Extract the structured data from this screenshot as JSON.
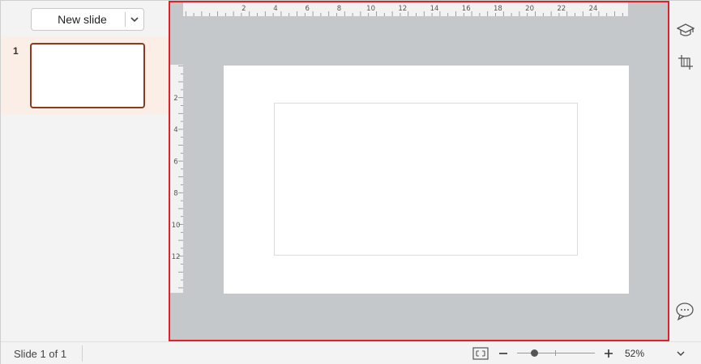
{
  "sidebar": {
    "new_slide_label": "New slide",
    "slides": [
      {
        "number": "1"
      }
    ]
  },
  "ruler": {
    "horizontal_labels": [
      "2",
      "4",
      "6",
      "8",
      "10",
      "12",
      "14",
      "16",
      "18",
      "20",
      "22",
      "24"
    ],
    "vertical_labels": [
      "2",
      "4",
      "6",
      "8",
      "10",
      "12"
    ]
  },
  "right_toolbar": {
    "icons": [
      "learn-icon",
      "crop-icon",
      "comments-icon"
    ]
  },
  "status_bar": {
    "slide_count": "Slide 1 of 1",
    "zoom": "52%",
    "zoom_level_fraction": 0.22
  },
  "colors": {
    "selection_border": "#e0202a",
    "active_thumb_border": "#8b3a1f",
    "active_row_bg": "#fbeee7",
    "canvas_bg": "#c5c8cb"
  }
}
